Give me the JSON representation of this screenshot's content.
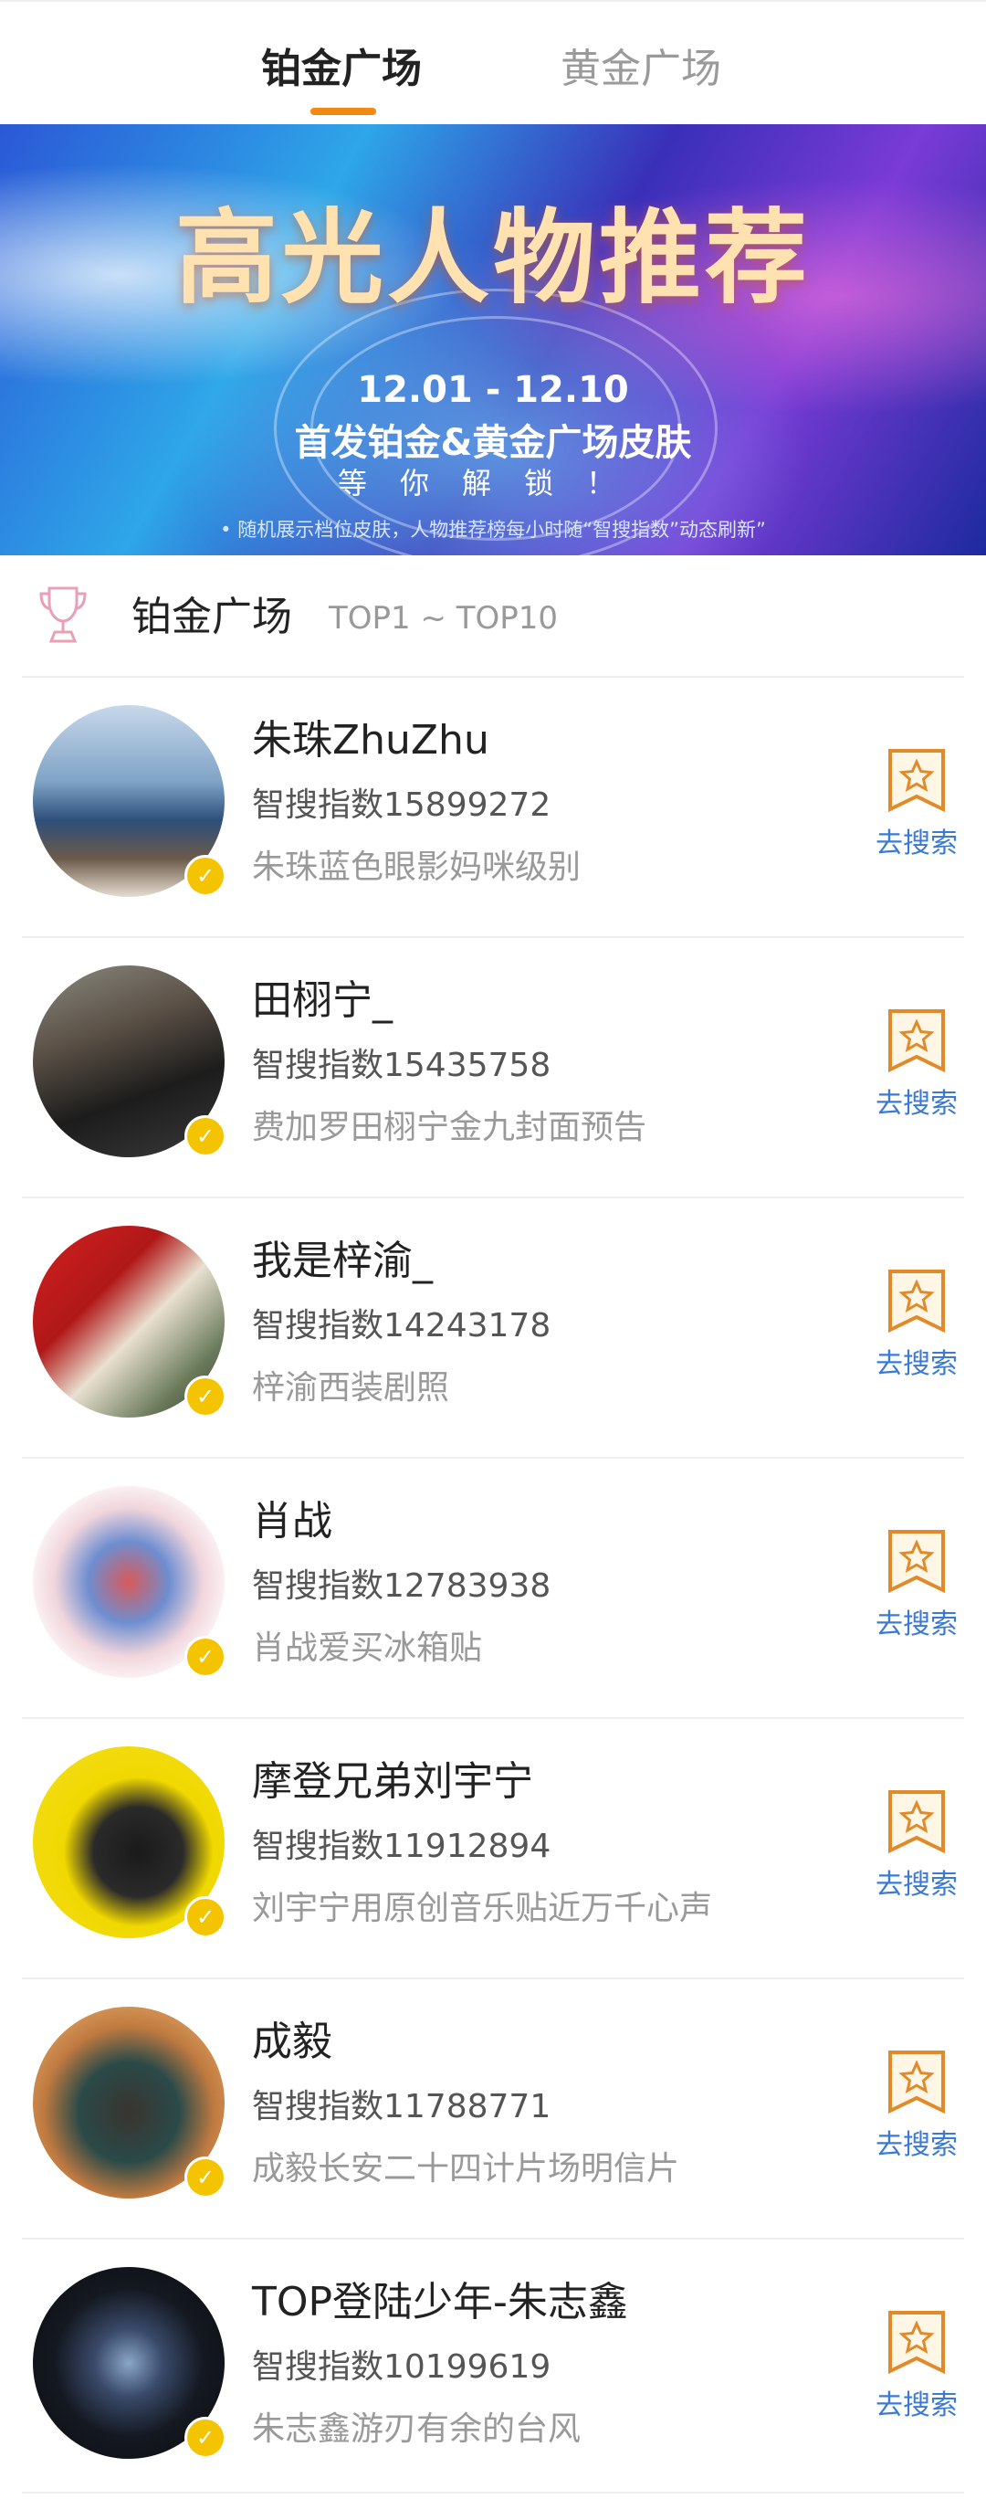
{
  "tabs": {
    "active": "铂金广场",
    "inactive": "黄金广场"
  },
  "banner": {
    "title": "高光人物推荐",
    "date": "12.01 - 12.10",
    "subtitle": "首发铂金&黄金广场皮肤",
    "unlock": "等你解锁！",
    "note": "• 随机展示档位皮肤，人物推荐榜每小时随“智搜指数”动态刷新”"
  },
  "section": {
    "title": "铂金广场",
    "range": "TOP1 ~ TOP10"
  },
  "search_label": "去搜索",
  "rows": [
    {
      "name": "朱珠ZhuZhu",
      "index": "智搜指数15899272",
      "desc": "朱珠蓝色眼影妈咪级别"
    },
    {
      "name": "田栩宁_",
      "index": "智搜指数15435758",
      "desc": "费加罗田栩宁金九封面预告"
    },
    {
      "name": "我是梓渝_",
      "index": "智搜指数14243178",
      "desc": "梓渝西装剧照"
    },
    {
      "name": "肖战",
      "index": "智搜指数12783938",
      "desc": "肖战爱买冰箱贴"
    },
    {
      "name": "摩登兄弟刘宇宁",
      "index": "智搜指数11912894",
      "desc": "刘宇宁用原创音乐贴近万千心声"
    },
    {
      "name": "成毅",
      "index": "智搜指数11788771",
      "desc": "成毅长安二十四计片场明信片"
    },
    {
      "name": "TOP登陆少年-朱志鑫",
      "index": "智搜指数10199619",
      "desc": "朱志鑫游刃有余的台风"
    }
  ],
  "colors": {
    "accent": "#f08a12",
    "link": "#3a7ad6",
    "badge": "#f5c400"
  }
}
